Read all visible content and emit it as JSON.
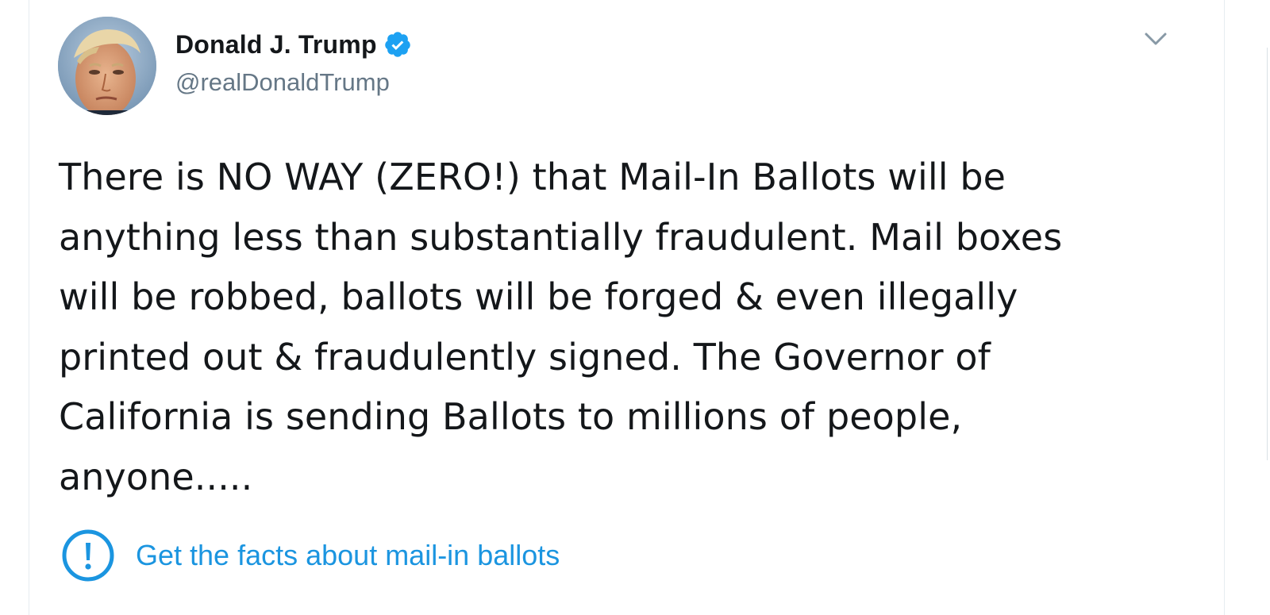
{
  "tweet": {
    "author": {
      "display_name": "Donald J. Trump",
      "handle": "@realDonaldTrump",
      "verified": true
    },
    "text": "There is NO WAY (ZERO!) that Mail-In Ballots will be\nanything less than substantially fraudulent. Mail boxes\nwill be robbed, ballots will be forged & even illegally\nprinted out & fraudulently signed. The Governor of\nCalifornia is sending Ballots to millions of people,\nanyone.....",
    "fact_check": {
      "label": "Get the facts about mail-in ballots",
      "icon": "exclamation-circle-icon"
    }
  },
  "colors": {
    "link_blue": "#1b95e0",
    "text_primary": "#14171a",
    "text_secondary": "#657786",
    "verified_blue": "#1da1f2"
  },
  "icons": {
    "menu": "chevron-down-icon",
    "verified": "verified-badge-icon"
  }
}
